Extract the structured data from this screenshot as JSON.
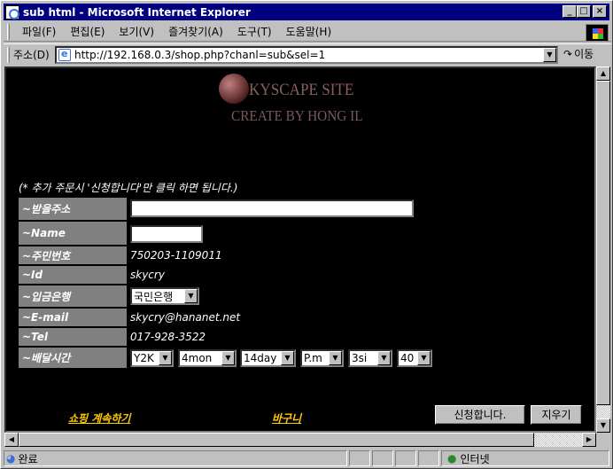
{
  "window": {
    "title": "sub html - Microsoft Internet Explorer"
  },
  "menu": [
    {
      "text": "파일",
      "key": "(F)"
    },
    {
      "text": "편집",
      "key": "(E)"
    },
    {
      "text": "보기",
      "key": "(V)"
    },
    {
      "text": "즐겨찾기",
      "key": "(A)"
    },
    {
      "text": "도구",
      "key": "(T)"
    },
    {
      "text": "도움말",
      "key": "(H)"
    }
  ],
  "address": {
    "label": "주소(D)",
    "url": "http://192.168.0.3/shop.php?chanl=sub&sel=1",
    "go": "이동"
  },
  "banner": {
    "line1": "KYSCAPE SITE",
    "line2": "CREATE BY HONG IL"
  },
  "form": {
    "note": "(* 추가 주문시 '신청합니다'만 클릭 하면 됩니다.)",
    "rows": {
      "address_label": "~받을주소",
      "name_label": "~Name",
      "ssn_label": "~주민번호",
      "ssn_value": "750203-1109011",
      "id_label": "~Id",
      "id_value": "skycry",
      "bank_label": "~입금은행",
      "bank_value": "국민은행",
      "email_label": "~E-mail",
      "email_value": "skycry@hananet.net",
      "tel_label": "~Tel",
      "tel_value": "017-928-3522",
      "time_label": "~배달시간"
    },
    "delivery": {
      "year": "Y2K",
      "month": "4mon",
      "day": "14day",
      "ampm": "P.m",
      "hour": "3si",
      "minute": "40"
    }
  },
  "actions": {
    "continue": "쇼핑 계속하기",
    "cart": "바구니",
    "submit": "신청합니다.",
    "clear": "지우기"
  },
  "status": {
    "left": "완료",
    "zone": "인터넷"
  }
}
